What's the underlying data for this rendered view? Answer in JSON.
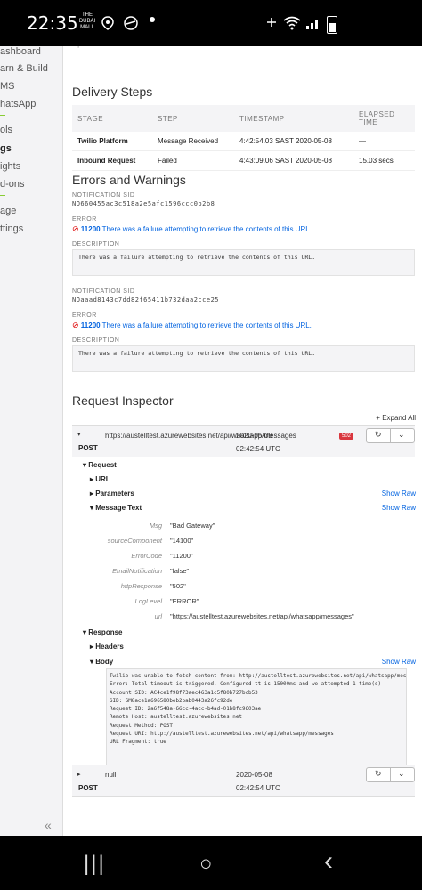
{
  "status_bar": {
    "time": "22:35",
    "brand": "THE DUBAI MALL",
    "icons": [
      "location-icon",
      "voicemail-icon",
      "wifi-icon",
      "signal-icon",
      "battery-icon"
    ]
  },
  "sidebar": {
    "items": [
      "ashboard",
      "arn & Build",
      "MS",
      "hatsApp",
      "ols",
      "gs",
      "ights",
      "d-ons",
      "age",
      "ttings"
    ],
    "collapse": "«"
  },
  "delivery_steps": {
    "title": "Delivery Steps",
    "columns": [
      "STAGE",
      "STEP",
      "TIMESTAMP",
      "ELAPSED TIME"
    ],
    "rows": [
      {
        "stage": "Twilio Platform",
        "step": "Message Received",
        "timestamp": "4:42:54.03 SAST 2020-05-08",
        "elapsed": "—"
      },
      {
        "stage": "Inbound Request",
        "step": "Failed",
        "timestamp": "4:43:09.06 SAST 2020-05-08",
        "elapsed": "15.03 secs"
      }
    ]
  },
  "errors": {
    "title": "Errors and Warnings",
    "sid_label": "NOTIFICATION SID",
    "error_label": "ERROR",
    "desc_label": "DESCRIPTION",
    "items": [
      {
        "sid": "NO660455ac3c518a2e5afc1596ccc0b2b8",
        "code": "11200",
        "message": "There was a failure attempting to retrieve the contents of this URL.",
        "description": "There was a failure attempting to retrieve the contents of this URL."
      },
      {
        "sid": "NOaaad8143c7dd82f65411b732daa2cce25",
        "code": "11200",
        "message": "There was a failure attempting to retrieve the contents of this URL.",
        "description": "There was a failure attempting to retrieve the contents of this URL."
      }
    ]
  },
  "inspector": {
    "title": "Request Inspector",
    "expand_all": "+ Expand All",
    "show_raw": "Show Raw",
    "request1": {
      "url": "https://austelltest.azurewebsites.net/api/whatsapp/messages",
      "timestamp": "2020-05-08",
      "method": "POST",
      "time": "02:42:54 UTC",
      "badge": "502"
    },
    "sections": {
      "request": "Request",
      "url": "URL",
      "parameters": "Parameters",
      "message_text": "Message Text",
      "response": "Response",
      "headers": "Headers",
      "body": "Body"
    },
    "message_text": [
      {
        "key": "Msg",
        "value": "\"Bad Gateway\""
      },
      {
        "key": "sourceComponent",
        "value": "\"14100\""
      },
      {
        "key": "ErrorCode",
        "value": "\"11200\""
      },
      {
        "key": "EmailNotification",
        "value": "\"false\""
      },
      {
        "key": "httpResponse",
        "value": "\"502\""
      },
      {
        "key": "LogLevel",
        "value": "\"ERROR\""
      },
      {
        "key": "url",
        "value": "\"https://austelltest.azurewebsites.net/api/whatsapp/messages\""
      }
    ],
    "body_lines": [
      "Twilio was unable to fetch content from: http://austelltest.azurewebsites.net/api/whatsapp/messages",
      "Error: Total timeout is triggered. Configured tt is 15000ms and we attempted 1 time(s)",
      "Account SID: AC4ce1f98f73aec463a1c5f80b727bcb53",
      "SID: SM8ace1a696580beb2bab0443a26fc92de",
      "Request ID: 2a6f548a-66cc-4acc-b4ad-01b8fc9603ae",
      "Remote Host: austelltest.azurewebsites.net",
      "Request Method: POST",
      "Request URI: http://austelltest.azurewebsites.net/api/whatsapp/messages",
      "URL Fragment: true"
    ],
    "request2": {
      "url": "null",
      "timestamp": "2020-05-08",
      "method": "POST",
      "time": "02:42:54 UTC"
    }
  },
  "nav_bar": {
    "recent": "|||",
    "home": "○",
    "back": "‹"
  }
}
